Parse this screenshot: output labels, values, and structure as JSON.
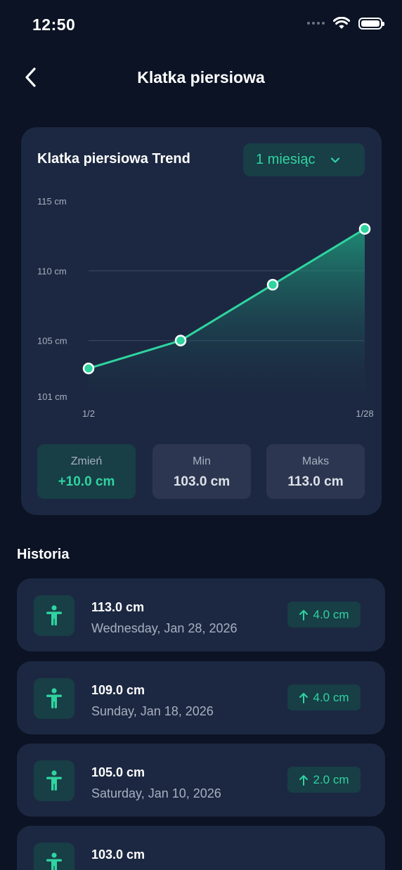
{
  "status_bar": {
    "time": "12:50"
  },
  "header": {
    "title": "Klatka piersiowa",
    "back_icon": "chevron-left-icon"
  },
  "trend": {
    "title": "Klatka piersiowa Trend",
    "period": "1 miesiąc",
    "accent_color": "#2fd4a0"
  },
  "chart_data": {
    "type": "area",
    "x": [
      "1/2",
      "1/12",
      "1/20",
      "1/28"
    ],
    "x_tick_labels": [
      "1/2",
      "1/28"
    ],
    "series": [
      {
        "values": [
          103.0,
          105.0,
          109.0,
          113.0
        ]
      }
    ],
    "y_ticks": [
      "101 cm",
      "105 cm",
      "110 cm",
      "115 cm"
    ],
    "ylim": [
      101,
      115
    ],
    "grid": true
  },
  "stats": {
    "change_label": "Zmień",
    "change_value": "+10.0 cm",
    "min_label": "Min",
    "min_value": "103.0 cm",
    "max_label": "Maks",
    "max_value": "113.0 cm"
  },
  "history": {
    "title": "Historia",
    "items": [
      {
        "value": "113.0 cm",
        "date": "Wednesday, Jan 28, 2026",
        "change": "4.0 cm"
      },
      {
        "value": "109.0 cm",
        "date": "Sunday, Jan 18, 2026",
        "change": "4.0 cm"
      },
      {
        "value": "105.0 cm",
        "date": "Saturday, Jan 10, 2026",
        "change": "2.0 cm"
      },
      {
        "value": "103.0 cm",
        "date": "",
        "change": ""
      }
    ]
  }
}
